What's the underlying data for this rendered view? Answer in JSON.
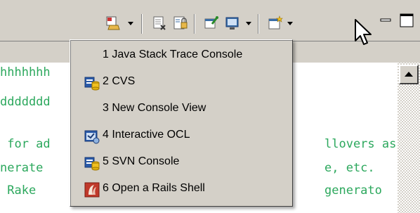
{
  "console": {
    "lines": [
      "hhhhhhh",
      "ddddddd",
      "",
      " for ad",
      "nerate",
      " Rake"
    ],
    "right_fragments": [
      "llovers as",
      "e, etc.",
      "generato"
    ]
  },
  "menu": {
    "items": [
      {
        "label": "1 Java Stack Trace Console",
        "icon": "none"
      },
      {
        "label": "2 CVS",
        "icon": "cvs-icon"
      },
      {
        "label": "3 New Console View",
        "icon": "none"
      },
      {
        "label": "4 Interactive OCL",
        "icon": "ocl-icon"
      },
      {
        "label": "5 SVN Console",
        "icon": "svn-icon"
      },
      {
        "label": "6 Open a Rails Shell",
        "icon": "rails-icon"
      }
    ]
  },
  "colors": {
    "console_text": "#2ca85d",
    "chrome": "#d4d0c8"
  }
}
